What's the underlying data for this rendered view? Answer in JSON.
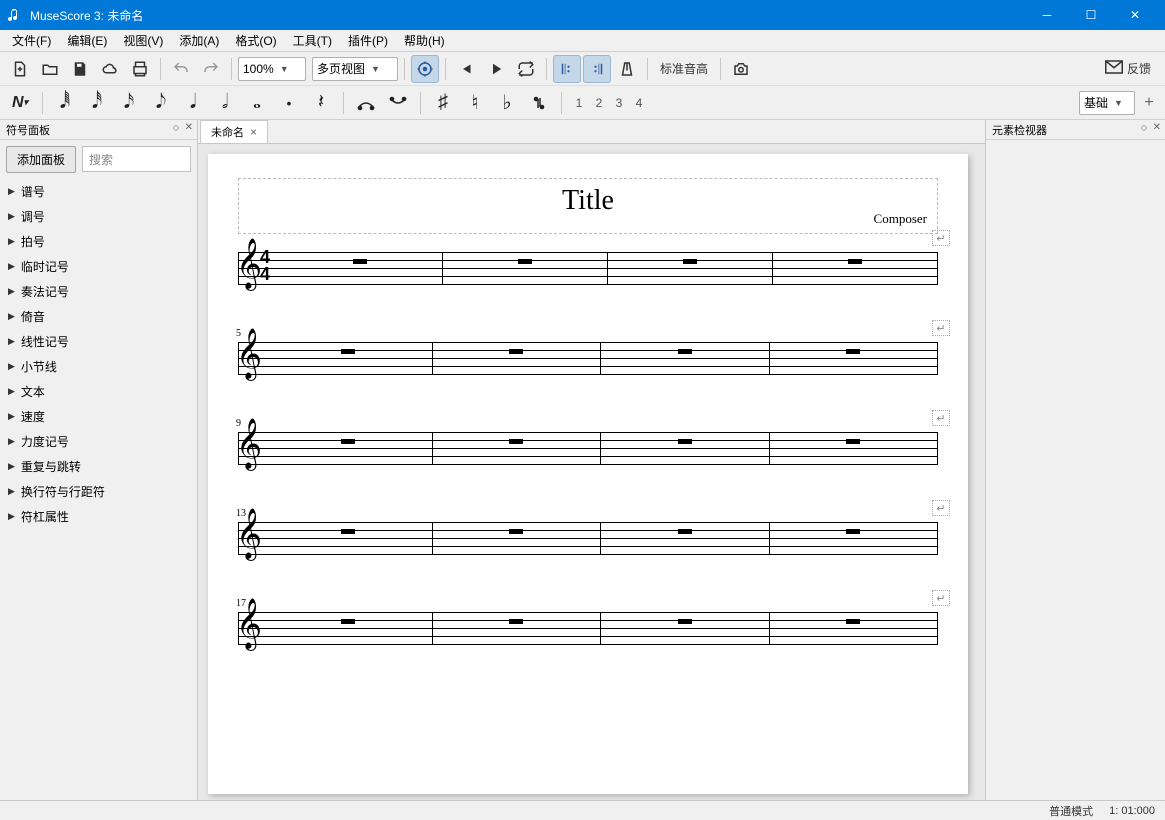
{
  "window": {
    "title": "MuseScore 3: 未命名"
  },
  "menus": [
    "文件(F)",
    "编辑(E)",
    "视图(V)",
    "添加(A)",
    "格式(O)",
    "工具(T)",
    "插件(P)",
    "帮助(H)"
  ],
  "toolbar": {
    "zoom": "100%",
    "view_mode": "多页视图",
    "pitch_label": "标准音高",
    "feedback": "反馈"
  },
  "voices": [
    "1",
    "2",
    "3",
    "4"
  ],
  "workspace": {
    "label": "基础"
  },
  "palette": {
    "title": "符号面板",
    "add_button": "添加面板",
    "search_placeholder": "搜索",
    "items": [
      "谱号",
      "调号",
      "拍号",
      "临时记号",
      "奏法记号",
      "倚音",
      "线性记号",
      "小节线",
      "文本",
      "速度",
      "力度记号",
      "重复与跳转",
      "换行符与行距符",
      "符杠属性"
    ]
  },
  "inspector": {
    "title": "元素检视器"
  },
  "tabs": [
    {
      "label": "未命名"
    }
  ],
  "score": {
    "title": "Title",
    "composer": "Composer",
    "time_top": "4",
    "time_bottom": "4",
    "systems": [
      {
        "measure_number": "",
        "show_timesig": true,
        "bars": 4
      },
      {
        "measure_number": "5",
        "show_timesig": false,
        "bars": 4
      },
      {
        "measure_number": "9",
        "show_timesig": false,
        "bars": 4
      },
      {
        "measure_number": "13",
        "show_timesig": false,
        "bars": 4
      },
      {
        "measure_number": "17",
        "show_timesig": false,
        "bars": 4
      }
    ]
  },
  "statusbar": {
    "mode": "普通模式",
    "position": "1: 01:000"
  }
}
